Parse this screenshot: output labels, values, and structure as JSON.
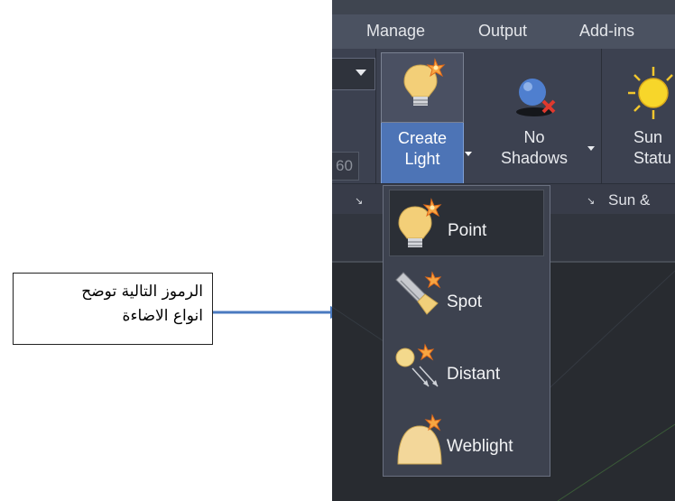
{
  "annotation": {
    "lines": [
      "الرموز التالية توضح",
      "انواع الاضاءة"
    ],
    "arrow_color": "#4a7ac0"
  },
  "ribbon": {
    "tabs": [
      "Manage",
      "Output",
      "Add-ins"
    ],
    "partial_value": "60",
    "create_light": {
      "line1": "Create",
      "line2": "Light"
    },
    "no_shadows": {
      "line1": "No",
      "line2": "Shadows"
    },
    "sun_status": {
      "line1": "Sun",
      "line2": "Statu"
    },
    "panel_footer_sun": "Sun &",
    "accent": "#4d74b6"
  },
  "light_menu": {
    "items": [
      {
        "label": "Point",
        "icon": "point-light-icon",
        "selected": true
      },
      {
        "label": "Spot",
        "icon": "spot-light-icon",
        "selected": false
      },
      {
        "label": "Distant",
        "icon": "distant-light-icon",
        "selected": false
      },
      {
        "label": "Weblight",
        "icon": "weblight-icon",
        "selected": false
      }
    ]
  }
}
